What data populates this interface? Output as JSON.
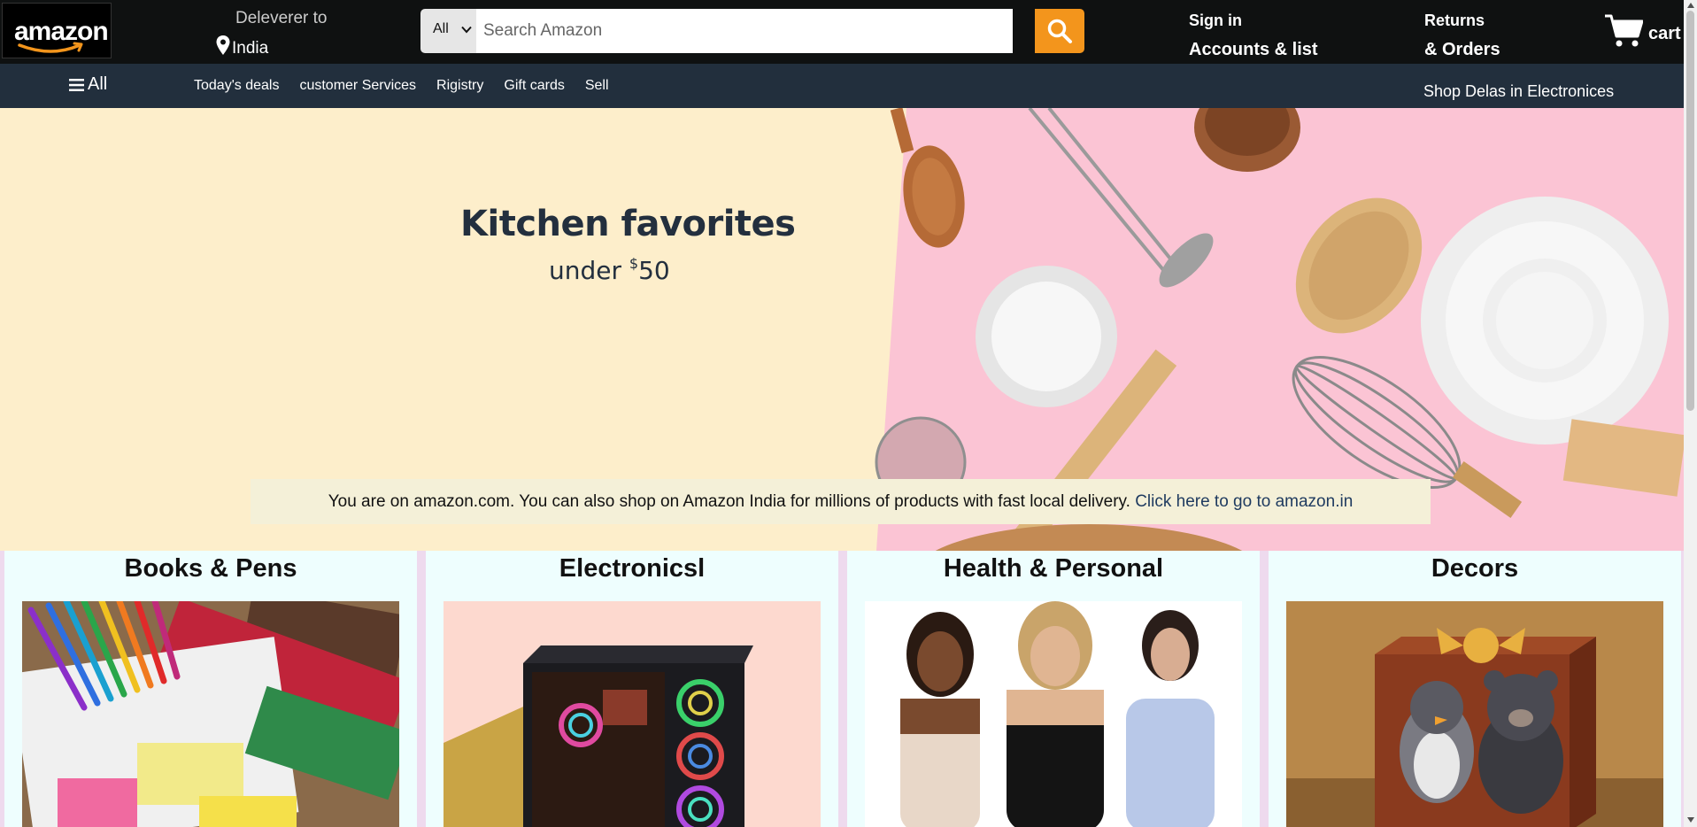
{
  "header": {
    "logo_text": "amazon",
    "deliver_label": "Deleverer to",
    "deliver_location": "India",
    "search_category": "All",
    "search_placeholder": "Search Amazon",
    "signin_label": "Sign in",
    "accounts_label": "Accounts & list",
    "returns_label": "Returns",
    "orders_label": "& Orders",
    "cart_label": "cart"
  },
  "subnav": {
    "all_label": "All",
    "links": [
      "Today's deals",
      "customer Services",
      "Rigistry",
      "Gift cards",
      "Sell"
    ],
    "promo": "Shop Delas in Electronices"
  },
  "hero": {
    "title": "Kitchen favorites",
    "subtitle_prefix": "under ",
    "currency": "$",
    "price": "50"
  },
  "notice": {
    "text": "You are on amazon.com. You can also shop on Amazon India for millions of products with fast local delivery. ",
    "link": "Click here to go to amazon.in"
  },
  "categories": [
    {
      "title": "Books & Pens"
    },
    {
      "title": "Electronicsl"
    },
    {
      "title": "Health & Personal"
    },
    {
      "title": "Decors"
    }
  ],
  "colors": {
    "topnav_bg": "#0f1111",
    "subnav_bg": "#222f3d",
    "search_button": "#f3951c",
    "hero_left_bg": "#fdeecb",
    "hero_right_bg": "#fbc4d4",
    "card_bg": "#eefefe"
  }
}
